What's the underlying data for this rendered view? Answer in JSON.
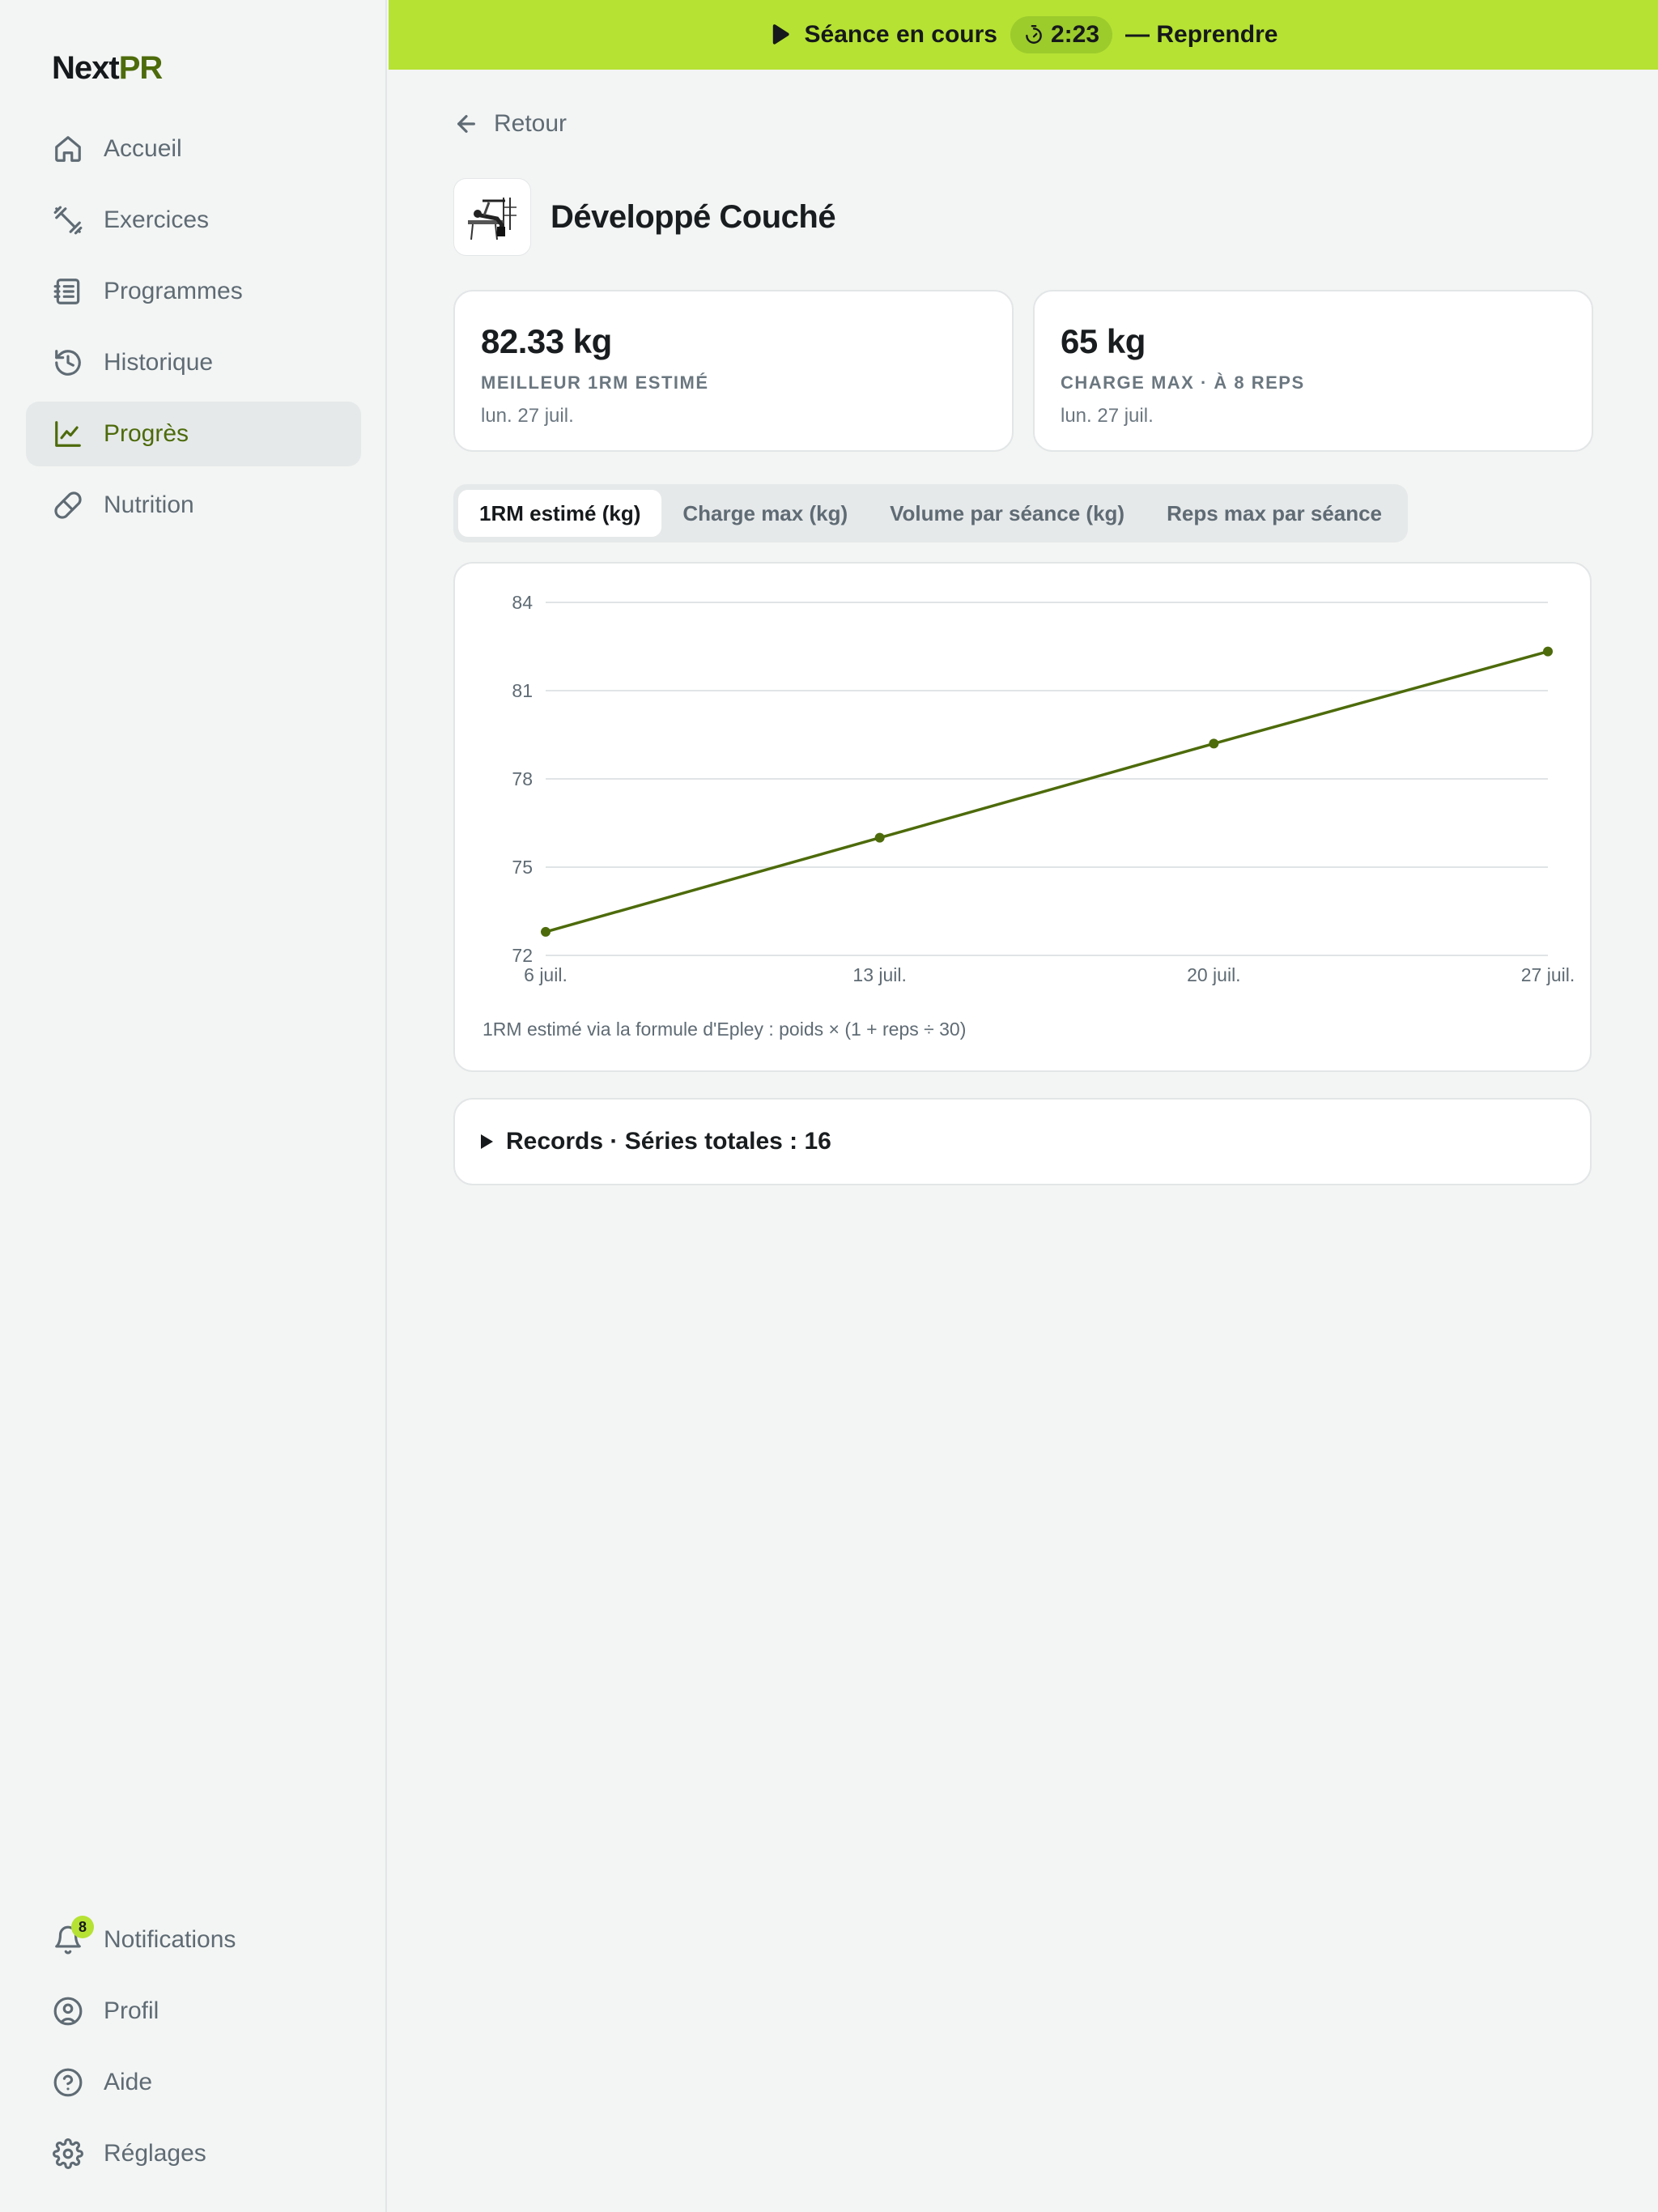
{
  "app": {
    "logo_part1": "Next",
    "logo_part2": "PR"
  },
  "sidebar": {
    "items": [
      {
        "label": "Accueil",
        "icon": "home-icon"
      },
      {
        "label": "Exercices",
        "icon": "dumbbell-icon"
      },
      {
        "label": "Programmes",
        "icon": "list-icon"
      },
      {
        "label": "Historique",
        "icon": "history-icon"
      },
      {
        "label": "Progrès",
        "icon": "chart-line-icon",
        "active": true
      },
      {
        "label": "Nutrition",
        "icon": "pill-icon"
      }
    ],
    "bottom_items": [
      {
        "label": "Notifications",
        "icon": "bell-icon",
        "badge": "8"
      },
      {
        "label": "Profil",
        "icon": "user-circle-icon"
      },
      {
        "label": "Aide",
        "icon": "help-circle-icon"
      },
      {
        "label": "Réglages",
        "icon": "gear-icon"
      }
    ]
  },
  "banner": {
    "session_label": "Séance en cours",
    "timer": "2:23",
    "resume_label": "— Reprendre"
  },
  "back_label": "Retour",
  "exercise": {
    "title": "Développé Couché"
  },
  "stats": [
    {
      "value": "82.33 kg",
      "label": "MEILLEUR 1RM ESTIMÉ",
      "date": "lun. 27 juil."
    },
    {
      "value": "65 kg",
      "label": "CHARGE MAX · À 8 REPS",
      "date": "lun. 27 juil."
    }
  ],
  "tabs": [
    {
      "label": "1RM estimé (kg)",
      "active": true
    },
    {
      "label": "Charge max (kg)"
    },
    {
      "label": "Volume par séance (kg)"
    },
    {
      "label": "Reps max par séance"
    }
  ],
  "chart_data": {
    "type": "line",
    "x": [
      "6 juil.",
      "13 juil.",
      "20 juil.",
      "27 juil."
    ],
    "series": [
      {
        "values": [
          72.8,
          76,
          79.2,
          82.33
        ]
      }
    ],
    "yticks": [
      72,
      75,
      78,
      81,
      84
    ],
    "ylim": [
      72,
      84
    ],
    "grid": true,
    "color": "#4d6b0b",
    "note": "1RM estimé via la formule d'Epley : poids × (1 + reps ÷ 30)"
  },
  "records": {
    "label": "Records · Séries totales : 16"
  },
  "colors": {
    "accent": "#b6e234",
    "brand_dark": "#4d6b0b",
    "background": "#f3f5f4"
  }
}
